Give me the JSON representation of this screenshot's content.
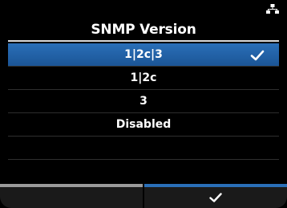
{
  "header": {
    "title": "SNMP Version",
    "status_icon": "network-icon"
  },
  "options": [
    {
      "label": "1|2c|3",
      "selected": true,
      "checked": true
    },
    {
      "label": "1|2c",
      "selected": false,
      "checked": false
    },
    {
      "label": "3",
      "selected": false,
      "checked": false
    },
    {
      "label": "Disabled",
      "selected": false,
      "checked": false
    },
    {
      "label": "",
      "selected": false,
      "checked": false
    }
  ],
  "footer": {
    "left_key_icon": "",
    "right_key_icon": "checkmark-icon"
  },
  "colors": {
    "accent": "#2a6fb8",
    "left_key_bar": "#9a9a9a",
    "background": "#000000"
  }
}
